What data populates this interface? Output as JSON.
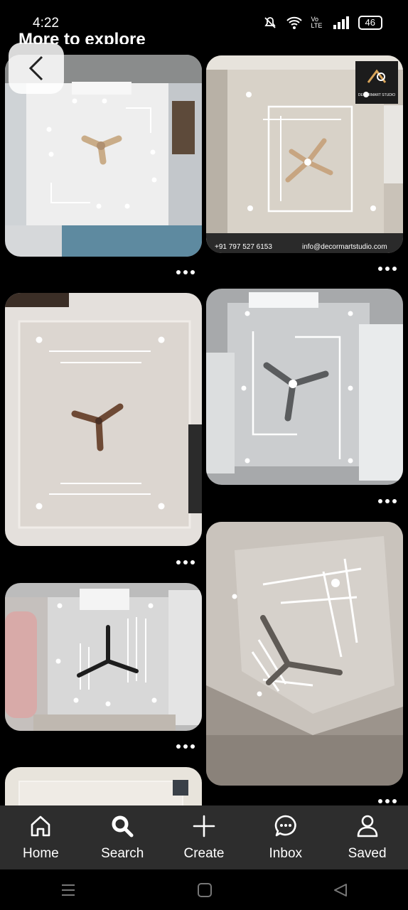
{
  "status": {
    "time": "4:22",
    "battery": "46",
    "network": "Vo LTE"
  },
  "header": {
    "title": "More to explore"
  },
  "pins": [
    {
      "id": 1
    },
    {
      "id": 2,
      "watermark_phone": "+91 797 527 6153",
      "watermark_email": "info@decormartstudio.com",
      "brand": "DECORMART STUDIO"
    },
    {
      "id": 3
    },
    {
      "id": 4
    },
    {
      "id": 5
    },
    {
      "id": 6
    },
    {
      "id": 7
    }
  ],
  "nav": {
    "home": "Home",
    "search": "Search",
    "create": "Create",
    "inbox": "Inbox",
    "saved": "Saved"
  }
}
